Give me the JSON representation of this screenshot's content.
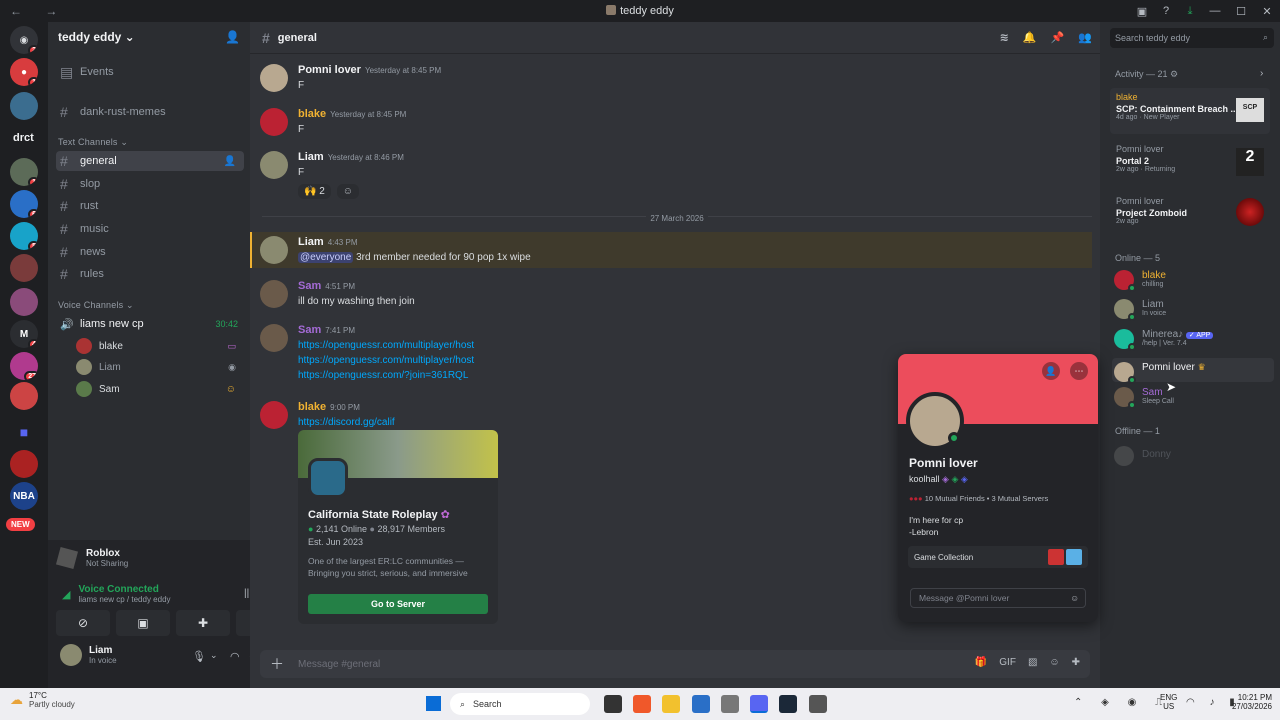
{
  "window": {
    "title": "teddy eddy"
  },
  "rail": {
    "label_drct": "drct",
    "new_badge": "NEW",
    "badges": [
      "2",
      "1",
      "",
      "1",
      "",
      "6",
      "1",
      "7",
      "5",
      "3",
      "",
      "",
      "4",
      "27",
      "",
      "",
      "",
      "",
      "",
      "",
      ""
    ]
  },
  "guild": {
    "name": "teddy eddy ⌄"
  },
  "channels": {
    "events": "Events",
    "dank": "dank-rust-memes",
    "text_cat": "Text Channels ⌄",
    "items": [
      "general",
      "slop",
      "rust",
      "music",
      "news",
      "rules"
    ],
    "voice_cat": "Voice Channels ⌄",
    "voice_channel": "liams new cp",
    "voice_time": "30:42",
    "voice_users": [
      "blake",
      "Liam",
      "Sam"
    ]
  },
  "activity_panel": {
    "game": "Roblox",
    "status": "Not Sharing"
  },
  "voice": {
    "status": "Voice Connected",
    "where": "liams new cp / teddy eddy"
  },
  "user": {
    "name": "Liam",
    "status": "In voice"
  },
  "chat": {
    "channel": "general",
    "composer_placeholder": "Message #general",
    "date_sep": "27 March 2026",
    "messages": [
      {
        "author": "Pomni lover",
        "time": "Yesterday at 8:45 PM",
        "text": "F",
        "color": "#f2f3f5"
      },
      {
        "author": "blake",
        "time": "Yesterday at 8:45 PM",
        "text": "F",
        "color": "#f0b232"
      },
      {
        "author": "Liam",
        "time": "Yesterday at 8:46 PM",
        "text": "F",
        "color": "#f2f3f5",
        "reaction": "2"
      },
      {
        "author": "Liam",
        "time": "4:43 PM",
        "mention": "@everyone",
        "text": " 3rd member needed for 90 pop 1x wipe",
        "color": "#f2f3f5"
      },
      {
        "author": "Sam",
        "time": "4:51 PM",
        "text": "ill do my washing then join",
        "color": "#a46bd6"
      },
      {
        "author": "Sam",
        "time": "7:41 PM",
        "links": [
          "https://openguessr.com/multiplayer/host",
          "https://openguessr.com/multiplayer/host",
          "https://openguessr.com/?join=361RQL"
        ],
        "color": "#a46bd6"
      },
      {
        "author": "blake",
        "time": "9:00 PM",
        "links": [
          "https://discord.gg/calif"
        ],
        "color": "#f0b232"
      }
    ]
  },
  "invite": {
    "name": "California State Roleplay",
    "online": "2,141 Online",
    "members": "28,917 Members",
    "est": "Est. Jun 2023",
    "desc": "One of the largest ER:LC communities — Bringing you strict, serious, and immersive roleplay — The California way.",
    "button": "Go to Server"
  },
  "search": {
    "placeholder": "Search teddy eddy"
  },
  "activity": {
    "header": "Activity — 21",
    "items": [
      {
        "user": "blake",
        "game": "SCP: Containment Breach ...",
        "meta": "4d ago",
        "tag": "New Player",
        "user_color": "#f0b232"
      },
      {
        "user": "Pomni lover",
        "game": "Portal 2",
        "meta": "2w ago",
        "tag": "Returning",
        "user_color": "#949ba4"
      },
      {
        "user": "Pomni lover",
        "game": "Project Zomboid",
        "meta": "2w ago",
        "tag": "",
        "user_color": "#949ba4"
      }
    ]
  },
  "member_list": {
    "online_header": "Online — 5",
    "online": [
      {
        "name": "blake",
        "sub": "chilling",
        "color": "#f0b232"
      },
      {
        "name": "Liam",
        "sub": "In voice",
        "color": "#949ba4"
      },
      {
        "name": "Minerea♪",
        "sub": "/help | Ver. 7.4",
        "color": "#949ba4",
        "app": "✓ APP"
      },
      {
        "name": "Pomni lover",
        "sub": "",
        "color": "#f2f3f5"
      },
      {
        "name": "Sam",
        "sub": "Sleep Call",
        "color": "#a46bd6"
      }
    ],
    "offline_header": "Offline — 1",
    "offline": [
      {
        "name": "Donny"
      }
    ]
  },
  "profile": {
    "display_name": "Pomni lover",
    "username": "koolhall",
    "mutuals": "10 Mutual Friends • 3 Mutual Servers",
    "bio1": "I'm here for cp",
    "bio2": "-Lebron",
    "collection": "Game Collection",
    "message_placeholder": "Message @Pomni lover"
  },
  "taskbar": {
    "temp": "17°C",
    "weather": "Partly cloudy",
    "search": "Search",
    "lang1": "ENG",
    "lang2": "US",
    "time": "10:21 PM",
    "date": "27/03/2026"
  },
  "colors": {
    "accent": "#5865f2",
    "banner": "#ec4d5c",
    "green": "#23a55a",
    "link": "#00a8fc",
    "mention_bg": "#3f3a2c"
  }
}
